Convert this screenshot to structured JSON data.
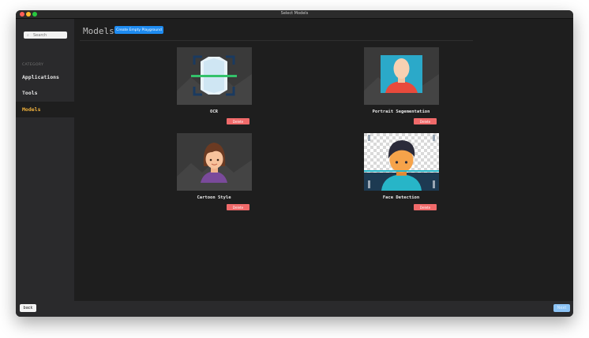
{
  "window": {
    "title": "Select Models"
  },
  "sidebar": {
    "search_placeholder": "Search",
    "category_label": "CATEGORY",
    "items": [
      {
        "label": "Applications",
        "selected": false
      },
      {
        "label": "Tools",
        "selected": false
      },
      {
        "label": "Models",
        "selected": true
      }
    ]
  },
  "main": {
    "title": "Models",
    "create_button": "Create Empty Playground",
    "cards": [
      {
        "name": "OCR",
        "delete_label": "Delete",
        "icon": "ocr-scan-icon"
      },
      {
        "name": "Portrait Segementation",
        "delete_label": "Delete",
        "icon": "portrait-segmentation-icon"
      },
      {
        "name": "Cartoon Style",
        "delete_label": "Delete",
        "icon": "cartoon-style-icon"
      },
      {
        "name": "Face Detection",
        "delete_label": "Delete",
        "icon": "face-detection-icon"
      }
    ]
  },
  "footer": {
    "back_label": "back",
    "next_label": "Next"
  },
  "colors": {
    "accent": "#1e8bf0",
    "selected_nav": "#f2b33d",
    "delete": "#f06a6a",
    "background": "#1e1e1e",
    "sidebar": "#2a2a2c"
  }
}
